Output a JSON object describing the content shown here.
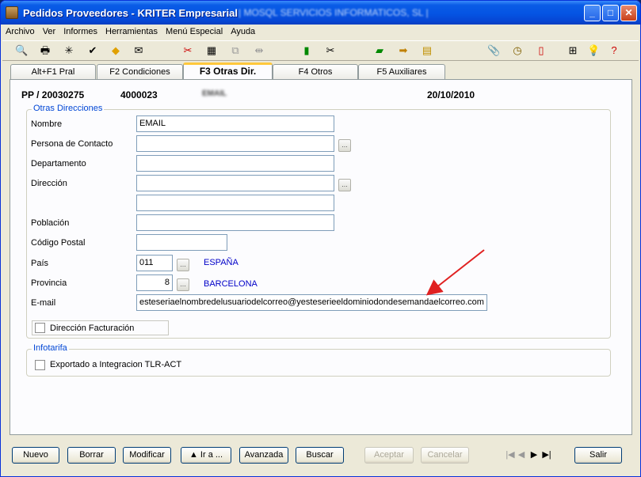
{
  "window": {
    "title": "Pedidos Proveedores - KRITER Empresarial",
    "title_blurred": "| MOSQL SERVICIOS INFORMATICOS, SL |",
    "controls": {
      "minimize": "_",
      "maximize": "□",
      "close": "✕"
    }
  },
  "menu": [
    "Archivo",
    "Ver",
    "Informes",
    "Herramientas",
    "Menú Especial",
    "Ayuda"
  ],
  "toolbar_icons": [
    "preview-icon",
    "print-icon",
    "asterisk-icon",
    "checklist-icon",
    "warning-icon",
    "stamp-icon",
    "tools-icon",
    "calculator-icon",
    "copy-icon",
    "merge-icon",
    "battery-icon",
    "scissors-icon",
    "book-icon",
    "arrow-icon",
    "notebook-icon",
    "paperclip-icon",
    "clock-icon",
    "document-icon",
    "tree-icon",
    "lightbulb-icon",
    "help-icon"
  ],
  "tabs": [
    "Alt+F1 Pral",
    "F2 Condiciones",
    "F3 Otras Dir.",
    "F4 Otros",
    "F5 Auxiliares"
  ],
  "active_tab": "F3 Otras Dir.",
  "header": {
    "doc_number": "PP / 20030275",
    "supplier_code": "4000023",
    "supplier_name": "EMAIL",
    "date": "20/10/2010"
  },
  "otras_direcciones": {
    "legend": "Otras Direcciones",
    "labels": {
      "nombre": "Nombre",
      "persona_contacto": "Persona de Contacto",
      "departamento": "Departamento",
      "direccion": "Dirección",
      "poblacion": "Población",
      "codigo_postal": "Código Postal",
      "pais": "País",
      "provincia": "Provincia",
      "email": "E-mail",
      "direccion_facturacion": "Dirección Facturación"
    },
    "values": {
      "nombre": "EMAIL",
      "persona_contacto": "",
      "departamento": "",
      "direccion_1": "",
      "direccion_2": "",
      "poblacion": "",
      "codigo_postal": "",
      "pais_code": "011",
      "pais_name": "ESPAÑA",
      "provincia_code": "8",
      "provincia_name": "BARCELONA",
      "email": "esteseriaelnombredelusuariodelcorreo@yesteserieeldominiodondesemandaelcorreo.com"
    },
    "ellipsis": "..."
  },
  "infotarifa": {
    "legend": "Infotarifa",
    "exportado_label": "Exportado a Integracion TLR-ACT"
  },
  "buttons": {
    "nuevo": "Nuevo",
    "borrar": "Borrar",
    "modificar": "Modificar",
    "ir_a": "▲ Ir a ...",
    "avanzada": "Avanzada",
    "buscar": "Buscar",
    "aceptar": "Aceptar",
    "cancelar": "Cancelar",
    "salir": "Salir"
  },
  "nav": {
    "first": "|◀",
    "prev": "◀",
    "next": "▶",
    "last": "▶|"
  },
  "colors": {
    "accent_link": "#0000c8",
    "group_legend": "#0046d5",
    "annotation_arrow": "#e02020"
  }
}
